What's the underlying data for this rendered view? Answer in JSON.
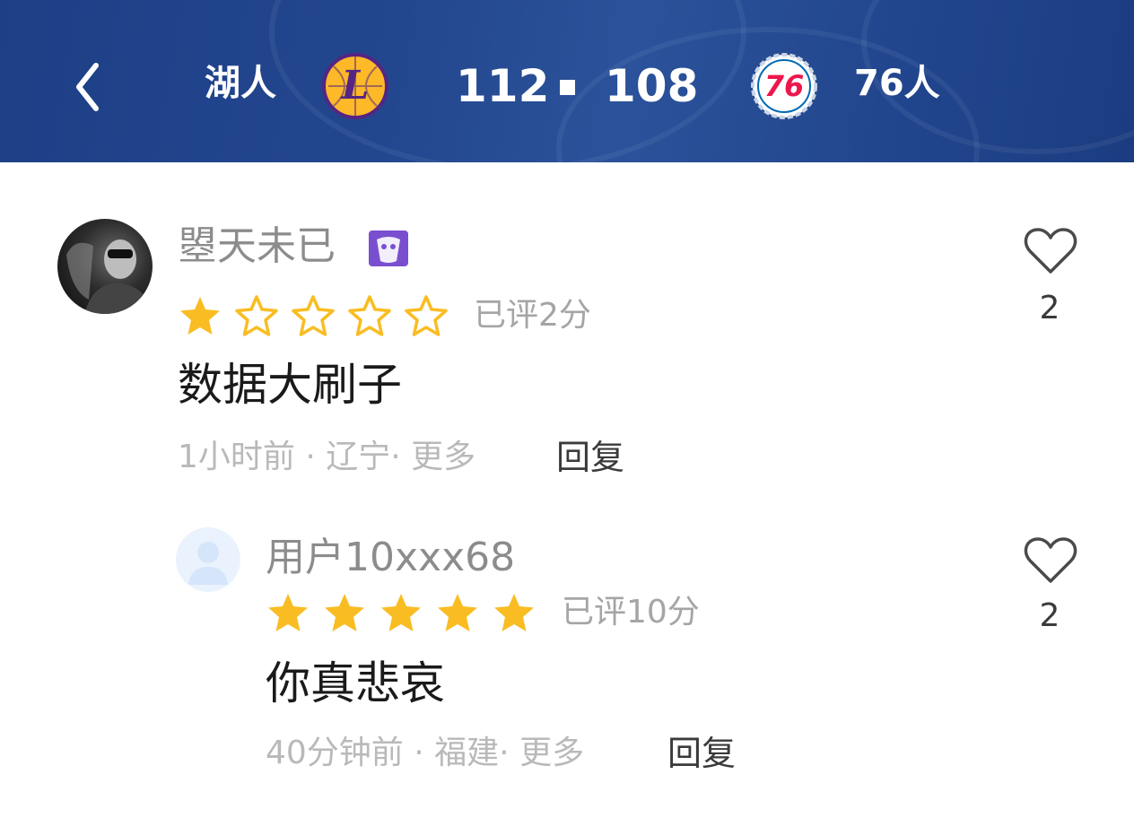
{
  "header": {
    "home_team": "湖人",
    "home_score": "112",
    "away_score": "108",
    "away_team": "76人",
    "home_logo_text": "L",
    "away_logo_text": "76"
  },
  "comments": [
    {
      "username": "曌天未已",
      "rating_stars": 1,
      "rating_text": "已评2分",
      "content": "数据大刷子",
      "time": "1小时前",
      "location": "辽宁·",
      "more": "更多",
      "reply": "回复",
      "likes": "2"
    },
    {
      "username": "用户10xxx68",
      "rating_stars": 5,
      "rating_text": "已评10分",
      "content": "你真悲哀",
      "time": "40分钟前",
      "location": "福建·",
      "more": "更多",
      "reply": "回复",
      "likes": "2"
    }
  ],
  "colors": {
    "header_bg": "#23478f",
    "star_filled": "#f9bd23",
    "star_outline": "#f9bd23",
    "lakers_purple": "#552583",
    "lakers_gold": "#fdb927",
    "sixers_red": "#ed174c",
    "sixers_blue": "#006bb6"
  }
}
